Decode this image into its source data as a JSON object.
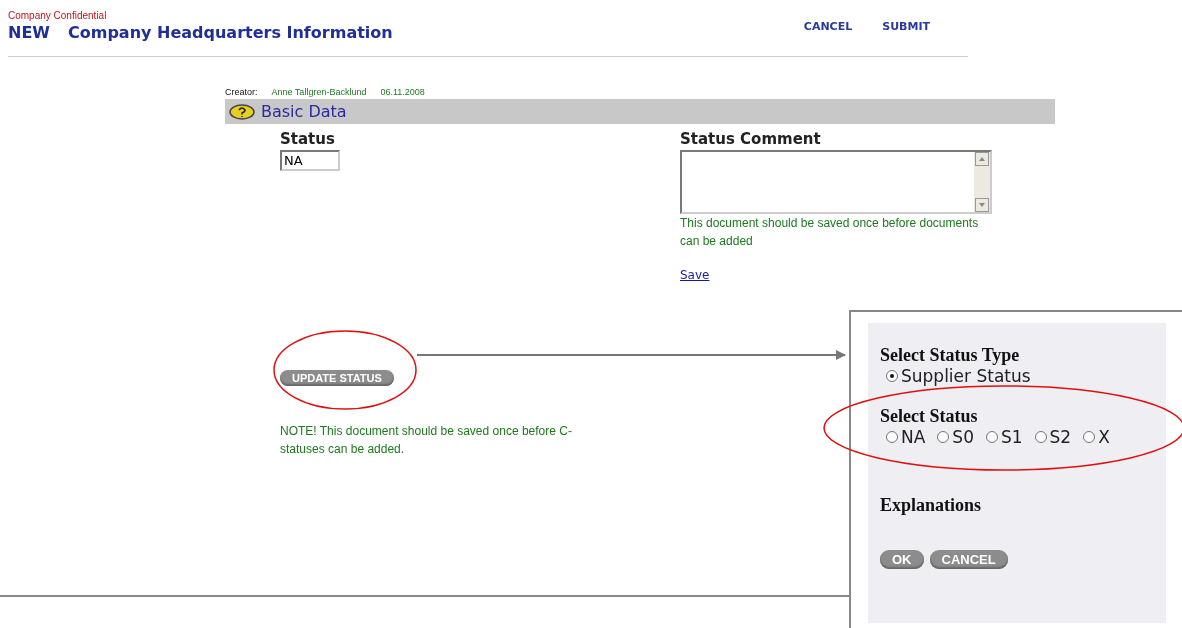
{
  "header": {
    "confidentiality": "Company Confidential",
    "badge": "NEW",
    "title": "Company Headquarters Information",
    "actions": [
      "CANCEL",
      "SUBMIT"
    ]
  },
  "meta": {
    "creator_label": "Creator:",
    "creator": "Anne Tallgren-Backlund",
    "date": "06.11.2008"
  },
  "section": {
    "title": "Basic Data"
  },
  "status": {
    "label": "Status",
    "value": "NA"
  },
  "status_comment": {
    "label": "Status Comment",
    "note": "This document should be saved once before documents can be added",
    "link": "Save"
  },
  "update_button": "UPDATE STATUS",
  "update_note": "NOTE! This document should be saved once before C-statuses can be added.",
  "dialog": {
    "type_heading": "Select Status Type",
    "types": [
      {
        "label": "Supplier Status",
        "selected": true
      }
    ],
    "status_heading": "Select Status",
    "statuses": [
      {
        "label": "NA",
        "selected": false
      },
      {
        "label": "S0",
        "selected": false
      },
      {
        "label": "S1",
        "selected": false
      },
      {
        "label": "S2",
        "selected": false
      },
      {
        "label": "X",
        "selected": false
      }
    ],
    "explanations_heading": "Explanations",
    "buttons": [
      "OK",
      "CANCEL"
    ]
  }
}
